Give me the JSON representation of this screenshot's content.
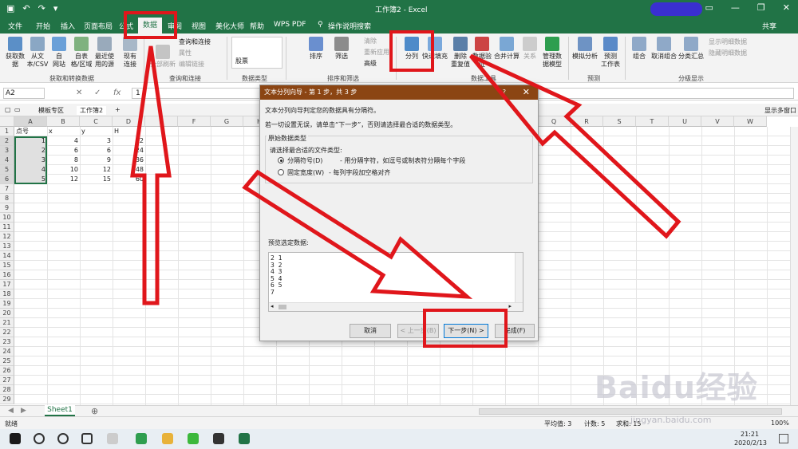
{
  "window": {
    "title": "工作簿2 - Excel"
  },
  "menu": [
    "文件",
    "开始",
    "插入",
    "页面布局",
    "公式",
    "数据",
    "审阅",
    "视图",
    "美化大师",
    "帮助",
    "WPS PDF",
    "操作说明搜索"
  ],
  "menu_active": "数据",
  "share": "共享",
  "ribbon": {
    "get_data": [
      "获取数\n据",
      "从文\n本/CSV",
      "自\n网站",
      "自表\n格/区域",
      "最近使\n用的源",
      "现有\n连接"
    ],
    "group1": "获取和转换数据",
    "refresh": "全部刷新",
    "queries": [
      "查询和连接",
      "属性",
      "编辑链接"
    ],
    "group2": "查询和连接",
    "stock": "股票",
    "group3": "数据类型",
    "sort": [
      "排序",
      "筛选"
    ],
    "filter_items": [
      "清除",
      "重新应用",
      "高级"
    ],
    "group4": "排序和筛选",
    "tools": [
      "分列",
      "快速填充",
      "删除\n重复值",
      "数据验\n证",
      "合并计算",
      "关系",
      "管理数\n据模型"
    ],
    "group5": "数据工具",
    "forecast": [
      "模拟分析",
      "预测\n工作表"
    ],
    "group6": "预测",
    "outline": [
      "组合",
      "取消组合",
      "分类汇总"
    ],
    "outline_items": [
      "显示明细数据",
      "隐藏明细数据"
    ],
    "group7": "分级显示"
  },
  "formula": {
    "namebox": "A2",
    "value": "1"
  },
  "tabs": [
    "模板专区",
    "工作簿2"
  ],
  "tabs_right": "显示多窗口",
  "columns": [
    "A",
    "B",
    "C",
    "D",
    "E",
    "F",
    "G",
    "H",
    "I",
    "J",
    "K",
    "L",
    "M",
    "N",
    "O",
    "P",
    "Q",
    "R",
    "S",
    "T",
    "U",
    "V",
    "W"
  ],
  "rows": [
    "1",
    "2",
    "3",
    "4",
    "5",
    "6",
    "7",
    "8",
    "9",
    "10",
    "11",
    "12",
    "13",
    "14",
    "15",
    "16",
    "17",
    "18",
    "19",
    "20",
    "21",
    "22",
    "23",
    "24",
    "25",
    "26",
    "27",
    "28",
    "29"
  ],
  "cells": [
    [
      "点号",
      "x",
      "y",
      "H"
    ],
    [
      "1",
      "4",
      "3",
      "12"
    ],
    [
      "2",
      "6",
      "6",
      "24"
    ],
    [
      "3",
      "8",
      "9",
      "36"
    ],
    [
      "4",
      "10",
      "12",
      "48"
    ],
    [
      "5",
      "12",
      "15",
      "60"
    ]
  ],
  "sheet_tab": "Sheet1",
  "status": {
    "ready": "就绪",
    "avg": "平均值: 3",
    "count": "计数: 5",
    "sum": "求和: 15",
    "zoom": "100%"
  },
  "taskbar": {
    "time": "21:21",
    "date": "2020/2/13"
  },
  "dialog": {
    "title": "文本分列向导 - 第 1 步，共 3 步",
    "help": "?",
    "line1": "文本分列向导判定您的数据具有分隔符。",
    "line2": "若一切设置无误，请单击“下一步”，否则请选择最合适的数据类型。",
    "section": "原始数据类型",
    "choose": "请选择最合适的文件类型:",
    "opt1": "分隔符号(D)",
    "opt1_desc": "- 用分隔字符，如逗号或制表符分隔每个字段",
    "opt2": "固定宽度(W)",
    "opt2_desc": "- 每列字段加空格对齐",
    "preview_label": "预览选定数据:",
    "preview_rows": [
      "2 1",
      "3 2",
      "4 3",
      "5 4",
      "6 5",
      "7"
    ],
    "buttons": {
      "cancel": "取消",
      "back": "< 上一步(B)",
      "next": "下一步(N) >",
      "finish": "完成(F)"
    }
  },
  "watermark": "Baidu经验",
  "watermark_url": "jingyan.baidu.com"
}
